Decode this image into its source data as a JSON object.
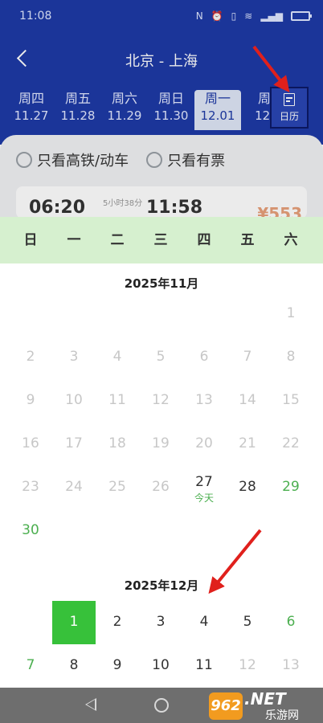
{
  "status_bar": {
    "time": "11:08",
    "icons": [
      "N",
      "⏰",
      "📳",
      "WiFi",
      "signal"
    ]
  },
  "header": {
    "route": "北京 - 上海",
    "calendar_button": "日历"
  },
  "date_tabs": [
    {
      "weekday": "周四",
      "date": "11.27"
    },
    {
      "weekday": "周五",
      "date": "11.28"
    },
    {
      "weekday": "周六",
      "date": "11.29"
    },
    {
      "weekday": "周日",
      "date": "11.30"
    },
    {
      "weekday": "周一",
      "date": "12.01",
      "selected": true
    },
    {
      "weekday": "周",
      "date": "12."
    }
  ],
  "filters": {
    "high_speed": "只看高铁/动车",
    "available": "只看有票"
  },
  "train_preview": {
    "depart": "06:20",
    "duration": "5小时38分",
    "arrive": "11:58",
    "price": "¥553"
  },
  "calendar": {
    "weekdays": [
      "日",
      "一",
      "二",
      "三",
      "四",
      "五",
      "六"
    ],
    "today_label": "今天",
    "months": [
      {
        "title": "2025年11月",
        "weeks": [
          [
            "",
            "",
            "",
            "",
            "",
            "",
            "1"
          ],
          [
            "2",
            "3",
            "4",
            "5",
            "6",
            "7",
            "8"
          ],
          [
            "9",
            "10",
            "11",
            "12",
            "13",
            "14",
            "15"
          ],
          [
            "16",
            "17",
            "18",
            "19",
            "20",
            "21",
            "22"
          ],
          [
            "23",
            "24",
            "25",
            "26",
            "27",
            "28",
            "29"
          ],
          [
            "30",
            "",
            "",
            "",
            "",
            "",
            ""
          ]
        ]
      },
      {
        "title": "2025年12月",
        "weeks": [
          [
            "",
            "1",
            "2",
            "3",
            "4",
            "5",
            "6"
          ],
          [
            "7",
            "8",
            "9",
            "10",
            "11",
            "12",
            "13"
          ]
        ]
      }
    ]
  },
  "watermark": {
    "badge": "962",
    "net": ".NET",
    "cn": "乐游网"
  },
  "colors": {
    "header_blue": "#1e3aa6",
    "weekbar_green": "#d6f0cf",
    "selected_green": "#37c13a",
    "weekend_green": "#4caf50",
    "arrow_red": "#e0201c"
  }
}
